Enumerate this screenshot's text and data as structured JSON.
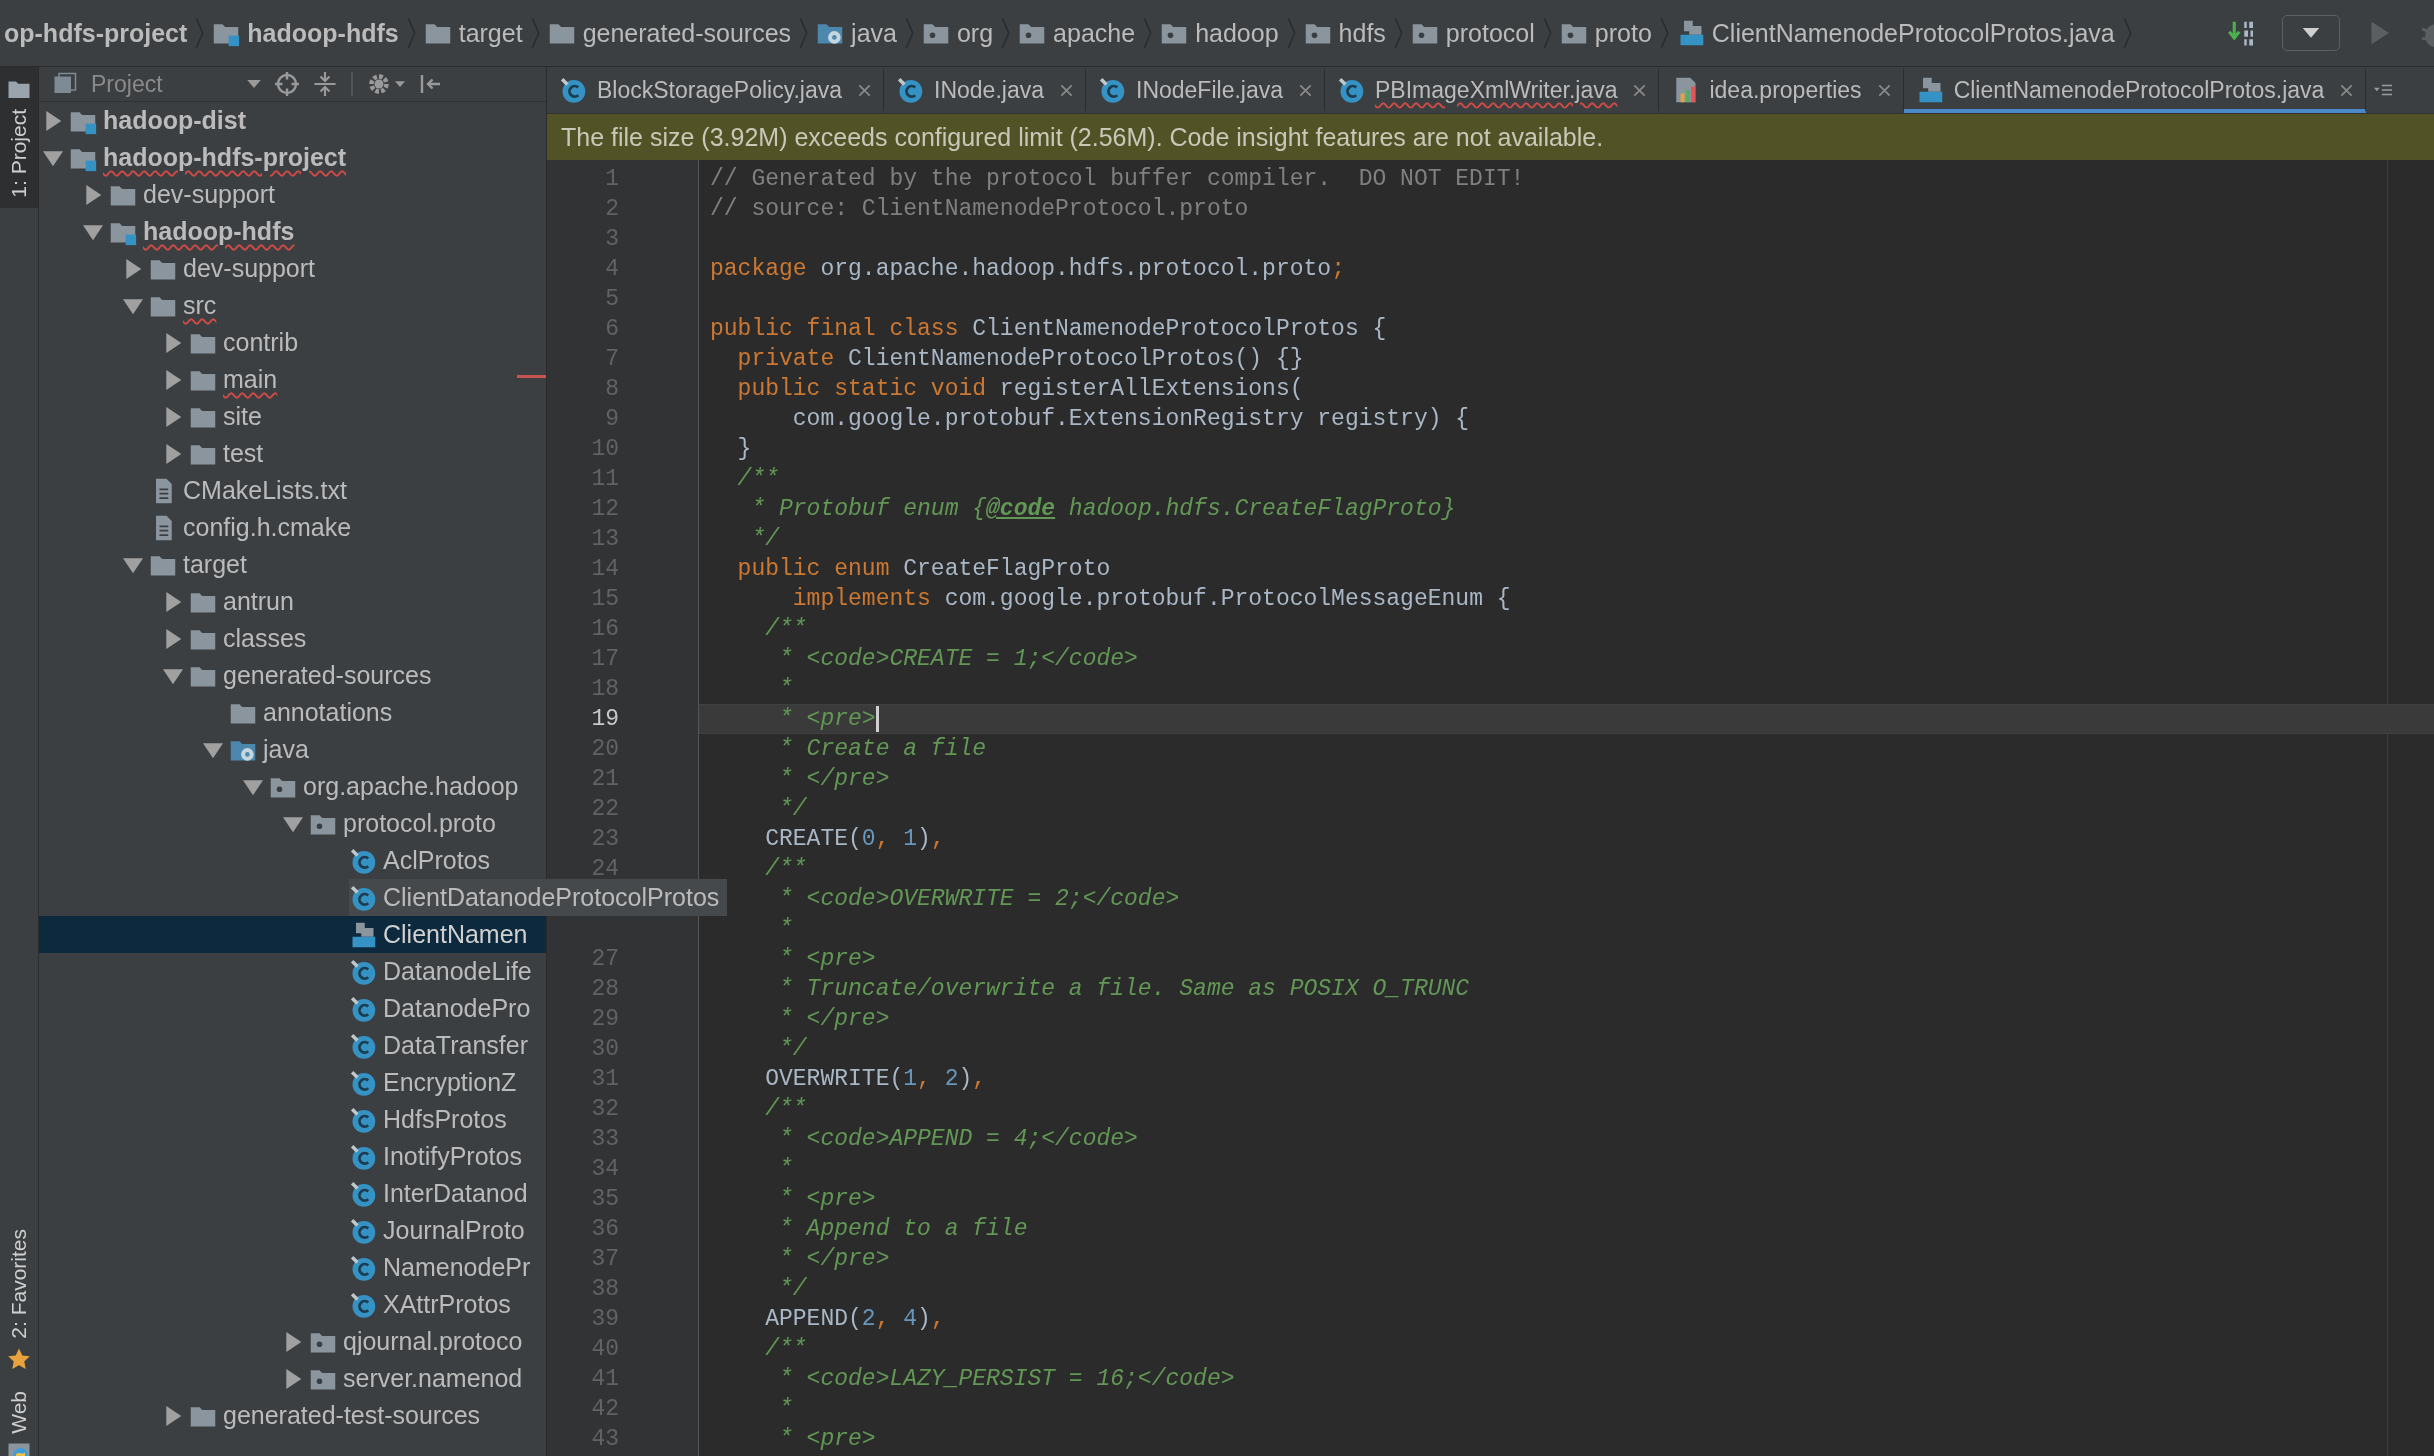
{
  "breadcrumbs": [
    {
      "label": "op-hdfs-project",
      "bold": true
    },
    {
      "label": "hadoop-hdfs",
      "kind": "module",
      "bold": true
    },
    {
      "label": "target",
      "kind": "folder",
      "bold": false
    },
    {
      "label": "generated-sources",
      "kind": "folder",
      "bold": false
    },
    {
      "label": "java",
      "kind": "source",
      "bold": false
    },
    {
      "label": "org",
      "kind": "package",
      "bold": false
    },
    {
      "label": "apache",
      "kind": "package",
      "bold": false
    },
    {
      "label": "hadoop",
      "kind": "package",
      "bold": false
    },
    {
      "label": "hdfs",
      "kind": "package",
      "bold": false
    },
    {
      "label": "protocol",
      "kind": "package",
      "bold": false
    },
    {
      "label": "proto",
      "kind": "package",
      "bold": false
    },
    {
      "label": "ClientNamenodeProtocolProtos.java",
      "kind": "java-file",
      "bold": false
    }
  ],
  "tool_stripe": [
    {
      "label": "1: Project",
      "kind": "project",
      "selected": true
    },
    {
      "label": "2: Favorites",
      "kind": "favorites",
      "selected": false
    },
    {
      "label": "Web",
      "kind": "web",
      "selected": false
    }
  ],
  "project_panel": {
    "title": "Project",
    "tree": [
      {
        "label": "hadoop-dist",
        "kind": "module",
        "expanded": false,
        "selected": false,
        "error": false
      },
      {
        "label": "hadoop-hdfs-project",
        "kind": "module",
        "expanded": true,
        "selected": false,
        "error": true,
        "children": [
          {
            "label": "dev-support",
            "kind": "folder",
            "expanded": false,
            "selected": false,
            "error": false
          },
          {
            "label": "hadoop-hdfs",
            "kind": "module",
            "expanded": true,
            "selected": false,
            "error": true,
            "children": [
              {
                "label": "dev-support",
                "kind": "folder",
                "expanded": false,
                "selected": false,
                "error": false
              },
              {
                "label": "src",
                "kind": "folder",
                "expanded": true,
                "selected": false,
                "error": true,
                "children": [
                  {
                    "label": "contrib",
                    "kind": "folder",
                    "expanded": false,
                    "selected": false,
                    "error": false
                  },
                  {
                    "label": "main",
                    "kind": "folder",
                    "expanded": false,
                    "selected": false,
                    "error": true
                  },
                  {
                    "label": "site",
                    "kind": "folder",
                    "expanded": false,
                    "selected": false,
                    "error": false
                  },
                  {
                    "label": "test",
                    "kind": "folder",
                    "expanded": false,
                    "selected": false,
                    "error": false
                  }
                ]
              },
              {
                "label": "CMakeLists.txt",
                "kind": "text-file",
                "selected": false,
                "error": false
              },
              {
                "label": "config.h.cmake",
                "kind": "text-file",
                "selected": false,
                "error": false
              },
              {
                "label": "target",
                "kind": "folder",
                "expanded": true,
                "selected": false,
                "error": false,
                "children": [
                  {
                    "label": "antrun",
                    "kind": "folder",
                    "expanded": false,
                    "selected": false,
                    "error": false
                  },
                  {
                    "label": "classes",
                    "kind": "folder",
                    "expanded": false,
                    "selected": false,
                    "error": false
                  },
                  {
                    "label": "generated-sources",
                    "kind": "folder",
                    "expanded": true,
                    "selected": false,
                    "error": false,
                    "children": [
                      {
                        "label": "annotations",
                        "kind": "folder",
                        "selected": false,
                        "error": false
                      },
                      {
                        "label": "java",
                        "kind": "source",
                        "expanded": true,
                        "selected": false,
                        "error": false,
                        "children": [
                          {
                            "label": "org.apache.hadoop",
                            "kind": "package",
                            "expanded": true,
                            "selected": false,
                            "error": false,
                            "children": [
                              {
                                "label": "protocol.proto",
                                "kind": "package",
                                "expanded": true,
                                "selected": false,
                                "error": false,
                                "children": [
                                  {
                                    "label": "AclProtos",
                                    "kind": "class",
                                    "selected": false,
                                    "error": false
                                  },
                                  {
                                    "label": "ClientDatanodeProtocolProtos",
                                    "kind": "class",
                                    "selected": false,
                                    "error": false,
                                    "hovered": true
                                  },
                                  {
                                    "label": "ClientNamen",
                                    "kind": "java-file",
                                    "selected": true,
                                    "error": false
                                  },
                                  {
                                    "label": "DatanodeLife",
                                    "kind": "class",
                                    "selected": false,
                                    "error": false
                                  },
                                  {
                                    "label": "DatanodePro",
                                    "kind": "class",
                                    "selected": false,
                                    "error": false
                                  },
                                  {
                                    "label": "DataTransfer",
                                    "kind": "class",
                                    "selected": false,
                                    "error": false
                                  },
                                  {
                                    "label": "EncryptionZ",
                                    "kind": "class",
                                    "selected": false,
                                    "error": false
                                  },
                                  {
                                    "label": "HdfsProtos",
                                    "kind": "class",
                                    "selected": false,
                                    "error": false
                                  },
                                  {
                                    "label": "InotifyProtos",
                                    "kind": "class",
                                    "selected": false,
                                    "error": false
                                  },
                                  {
                                    "label": "InterDatanod",
                                    "kind": "class",
                                    "selected": false,
                                    "error": false
                                  },
                                  {
                                    "label": "JournalProto",
                                    "kind": "class",
                                    "selected": false,
                                    "error": false
                                  },
                                  {
                                    "label": "NamenodePr",
                                    "kind": "class",
                                    "selected": false,
                                    "error": false
                                  },
                                  {
                                    "label": "XAttrProtos",
                                    "kind": "class",
                                    "selected": false,
                                    "error": false
                                  }
                                ]
                              },
                              {
                                "label": "qjournal.protoco",
                                "kind": "package",
                                "expanded": false,
                                "selected": false,
                                "error": false
                              },
                              {
                                "label": "server.namenod",
                                "kind": "package",
                                "expanded": false,
                                "selected": false,
                                "error": false
                              }
                            ]
                          }
                        ]
                      }
                    ]
                  },
                  {
                    "label": "generated-test-sources",
                    "kind": "folder",
                    "expanded": false,
                    "selected": false,
                    "error": false
                  }
                ]
              }
            ]
          }
        ]
      }
    ]
  },
  "tabs": [
    {
      "label": "BlockStoragePolicy.java",
      "kind": "class",
      "selected": false,
      "error": false
    },
    {
      "label": "INode.java",
      "kind": "class",
      "selected": false,
      "error": false
    },
    {
      "label": "INodeFile.java",
      "kind": "class",
      "selected": false,
      "error": false
    },
    {
      "label": "PBImageXmlWriter.java",
      "kind": "class",
      "selected": false,
      "error": true
    },
    {
      "label": "idea.properties",
      "kind": "properties",
      "selected": false,
      "error": false
    },
    {
      "label": "ClientNamenodeProtocolProtos.java",
      "kind": "java-file",
      "selected": true,
      "error": false
    }
  ],
  "notification": "The file size (3.92M) exceeds configured limit (2.56M). Code insight features are not available.",
  "editor": {
    "lines": [
      {
        "number": "1",
        "current": false,
        "tokens": [
          {
            "kind": "comment",
            "text": "// Generated by the protocol buffer compiler.  DO NOT EDIT!"
          }
        ]
      },
      {
        "number": "2",
        "current": false,
        "tokens": [
          {
            "kind": "comment",
            "text": "// source: ClientNamenodeProtocol.proto"
          }
        ]
      },
      {
        "number": "3",
        "current": false
      },
      {
        "number": "4",
        "current": false,
        "tokens": [
          {
            "kind": "keyword",
            "text": "package"
          },
          {
            "kind": "plain",
            "text": " org.apache.hadoop.hdfs.protocol.proto"
          },
          {
            "kind": "keyword",
            "text": ";"
          }
        ]
      },
      {
        "number": "5",
        "current": false
      },
      {
        "number": "6",
        "current": false,
        "tokens": [
          {
            "kind": "keyword",
            "text": "public final class"
          },
          {
            "kind": "plain",
            "text": " ClientNamenodeProtocolProtos {"
          }
        ]
      },
      {
        "number": "7",
        "current": false,
        "tokens": [
          {
            "kind": "keyword",
            "text": "  private"
          },
          {
            "kind": "plain",
            "text": " ClientNamenodeProtocolProtos() {}"
          }
        ]
      },
      {
        "number": "8",
        "current": false,
        "tokens": [
          {
            "kind": "keyword",
            "text": "  public static void"
          },
          {
            "kind": "plain",
            "text": " registerAllExtensions("
          }
        ]
      },
      {
        "number": "9",
        "current": false,
        "tokens": [
          {
            "kind": "plain",
            "text": "      com.google.protobuf.ExtensionRegistry registry) {"
          }
        ]
      },
      {
        "number": "10",
        "current": false,
        "tokens": [
          {
            "kind": "plain",
            "text": "  }"
          }
        ]
      },
      {
        "number": "11",
        "current": false,
        "tokens": [
          {
            "kind": "doc",
            "text": "  /**"
          }
        ]
      },
      {
        "number": "12",
        "current": false,
        "tokens": [
          {
            "kind": "doc",
            "text": "   * Protobuf enum {"
          },
          {
            "kind": "doc-tag",
            "text": "@code"
          },
          {
            "kind": "doc",
            "text": " hadoop.hdfs.CreateFlagProto}"
          }
        ]
      },
      {
        "number": "13",
        "current": false,
        "tokens": [
          {
            "kind": "doc",
            "text": "   */"
          }
        ]
      },
      {
        "number": "14",
        "current": false,
        "tokens": [
          {
            "kind": "keyword",
            "text": "  public enum"
          },
          {
            "kind": "plain",
            "text": " CreateFlagProto"
          }
        ]
      },
      {
        "number": "15",
        "current": false,
        "tokens": [
          {
            "kind": "keyword",
            "text": "      implements"
          },
          {
            "kind": "plain",
            "text": " com.google.protobuf.ProtocolMessageEnum {"
          }
        ]
      },
      {
        "number": "16",
        "current": false,
        "tokens": [
          {
            "kind": "doc",
            "text": "    /**"
          }
        ]
      },
      {
        "number": "17",
        "current": false,
        "tokens": [
          {
            "kind": "doc",
            "text": "     * <code>CREATE = 1;</code>"
          }
        ]
      },
      {
        "number": "18",
        "current": false,
        "tokens": [
          {
            "kind": "doc",
            "text": "     *"
          }
        ]
      },
      {
        "number": "19",
        "current": true,
        "tokens": [
          {
            "kind": "doc",
            "text": "     * <pre>"
          }
        ]
      },
      {
        "number": "20",
        "current": false,
        "tokens": [
          {
            "kind": "doc",
            "text": "     * Create a file"
          }
        ]
      },
      {
        "number": "21",
        "current": false,
        "tokens": [
          {
            "kind": "doc",
            "text": "     * </pre>"
          }
        ]
      },
      {
        "number": "22",
        "current": false,
        "tokens": [
          {
            "kind": "doc",
            "text": "     */"
          }
        ]
      },
      {
        "number": "23",
        "current": false,
        "tokens": [
          {
            "kind": "plain",
            "text": "    CREATE("
          },
          {
            "kind": "number",
            "text": "0"
          },
          {
            "kind": "keyword",
            "text": ", "
          },
          {
            "kind": "number",
            "text": "1"
          },
          {
            "kind": "plain",
            "text": ")"
          },
          {
            "kind": "keyword",
            "text": ","
          }
        ]
      },
      {
        "number": "24",
        "current": false,
        "tokens": [
          {
            "kind": "doc",
            "text": "    /**"
          }
        ]
      },
      {
        "current": false,
        "tokens": [
          {
            "kind": "doc",
            "text": "     * <code>OVERWRITE = 2;</code>"
          }
        ]
      },
      {
        "current": false,
        "tokens": [
          {
            "kind": "doc",
            "text": "     *"
          }
        ]
      },
      {
        "number": "27",
        "current": false,
        "tokens": [
          {
            "kind": "doc",
            "text": "     * <pre>"
          }
        ]
      },
      {
        "number": "28",
        "current": false,
        "tokens": [
          {
            "kind": "doc",
            "text": "     * Truncate/overwrite a file. Same as POSIX O_TRUNC"
          }
        ]
      },
      {
        "number": "29",
        "current": false,
        "tokens": [
          {
            "kind": "doc",
            "text": "     * </pre>"
          }
        ]
      },
      {
        "number": "30",
        "current": false,
        "tokens": [
          {
            "kind": "doc",
            "text": "     */"
          }
        ]
      },
      {
        "number": "31",
        "current": false,
        "tokens": [
          {
            "kind": "plain",
            "text": "    OVERWRITE("
          },
          {
            "kind": "number",
            "text": "1"
          },
          {
            "kind": "keyword",
            "text": ", "
          },
          {
            "kind": "number",
            "text": "2"
          },
          {
            "kind": "plain",
            "text": ")"
          },
          {
            "kind": "keyword",
            "text": ","
          }
        ]
      },
      {
        "number": "32",
        "current": false,
        "tokens": [
          {
            "kind": "doc",
            "text": "    /**"
          }
        ]
      },
      {
        "number": "33",
        "current": false,
        "tokens": [
          {
            "kind": "doc",
            "text": "     * <code>APPEND = 4;</code>"
          }
        ]
      },
      {
        "number": "34",
        "current": false,
        "tokens": [
          {
            "kind": "doc",
            "text": "     *"
          }
        ]
      },
      {
        "number": "35",
        "current": false,
        "tokens": [
          {
            "kind": "doc",
            "text": "     * <pre>"
          }
        ]
      },
      {
        "number": "36",
        "current": false,
        "tokens": [
          {
            "kind": "doc",
            "text": "     * Append to a file"
          }
        ]
      },
      {
        "number": "37",
        "current": false,
        "tokens": [
          {
            "kind": "doc",
            "text": "     * </pre>"
          }
        ]
      },
      {
        "number": "38",
        "current": false,
        "tokens": [
          {
            "kind": "doc",
            "text": "     */"
          }
        ]
      },
      {
        "number": "39",
        "current": false,
        "tokens": [
          {
            "kind": "plain",
            "text": "    APPEND("
          },
          {
            "kind": "number",
            "text": "2"
          },
          {
            "kind": "keyword",
            "text": ", "
          },
          {
            "kind": "number",
            "text": "4"
          },
          {
            "kind": "plain",
            "text": ")"
          },
          {
            "kind": "keyword",
            "text": ","
          }
        ]
      },
      {
        "number": "40",
        "current": false,
        "tokens": [
          {
            "kind": "doc",
            "text": "    /**"
          }
        ]
      },
      {
        "number": "41",
        "current": false,
        "tokens": [
          {
            "kind": "doc",
            "text": "     * <code>LAZY_PERSIST = 16;</code>"
          }
        ]
      },
      {
        "number": "42",
        "current": false,
        "tokens": [
          {
            "kind": "doc",
            "text": "     *"
          }
        ]
      },
      {
        "number": "43",
        "current": false,
        "tokens": [
          {
            "kind": "doc",
            "text": "     * <pre>"
          }
        ]
      }
    ]
  }
}
